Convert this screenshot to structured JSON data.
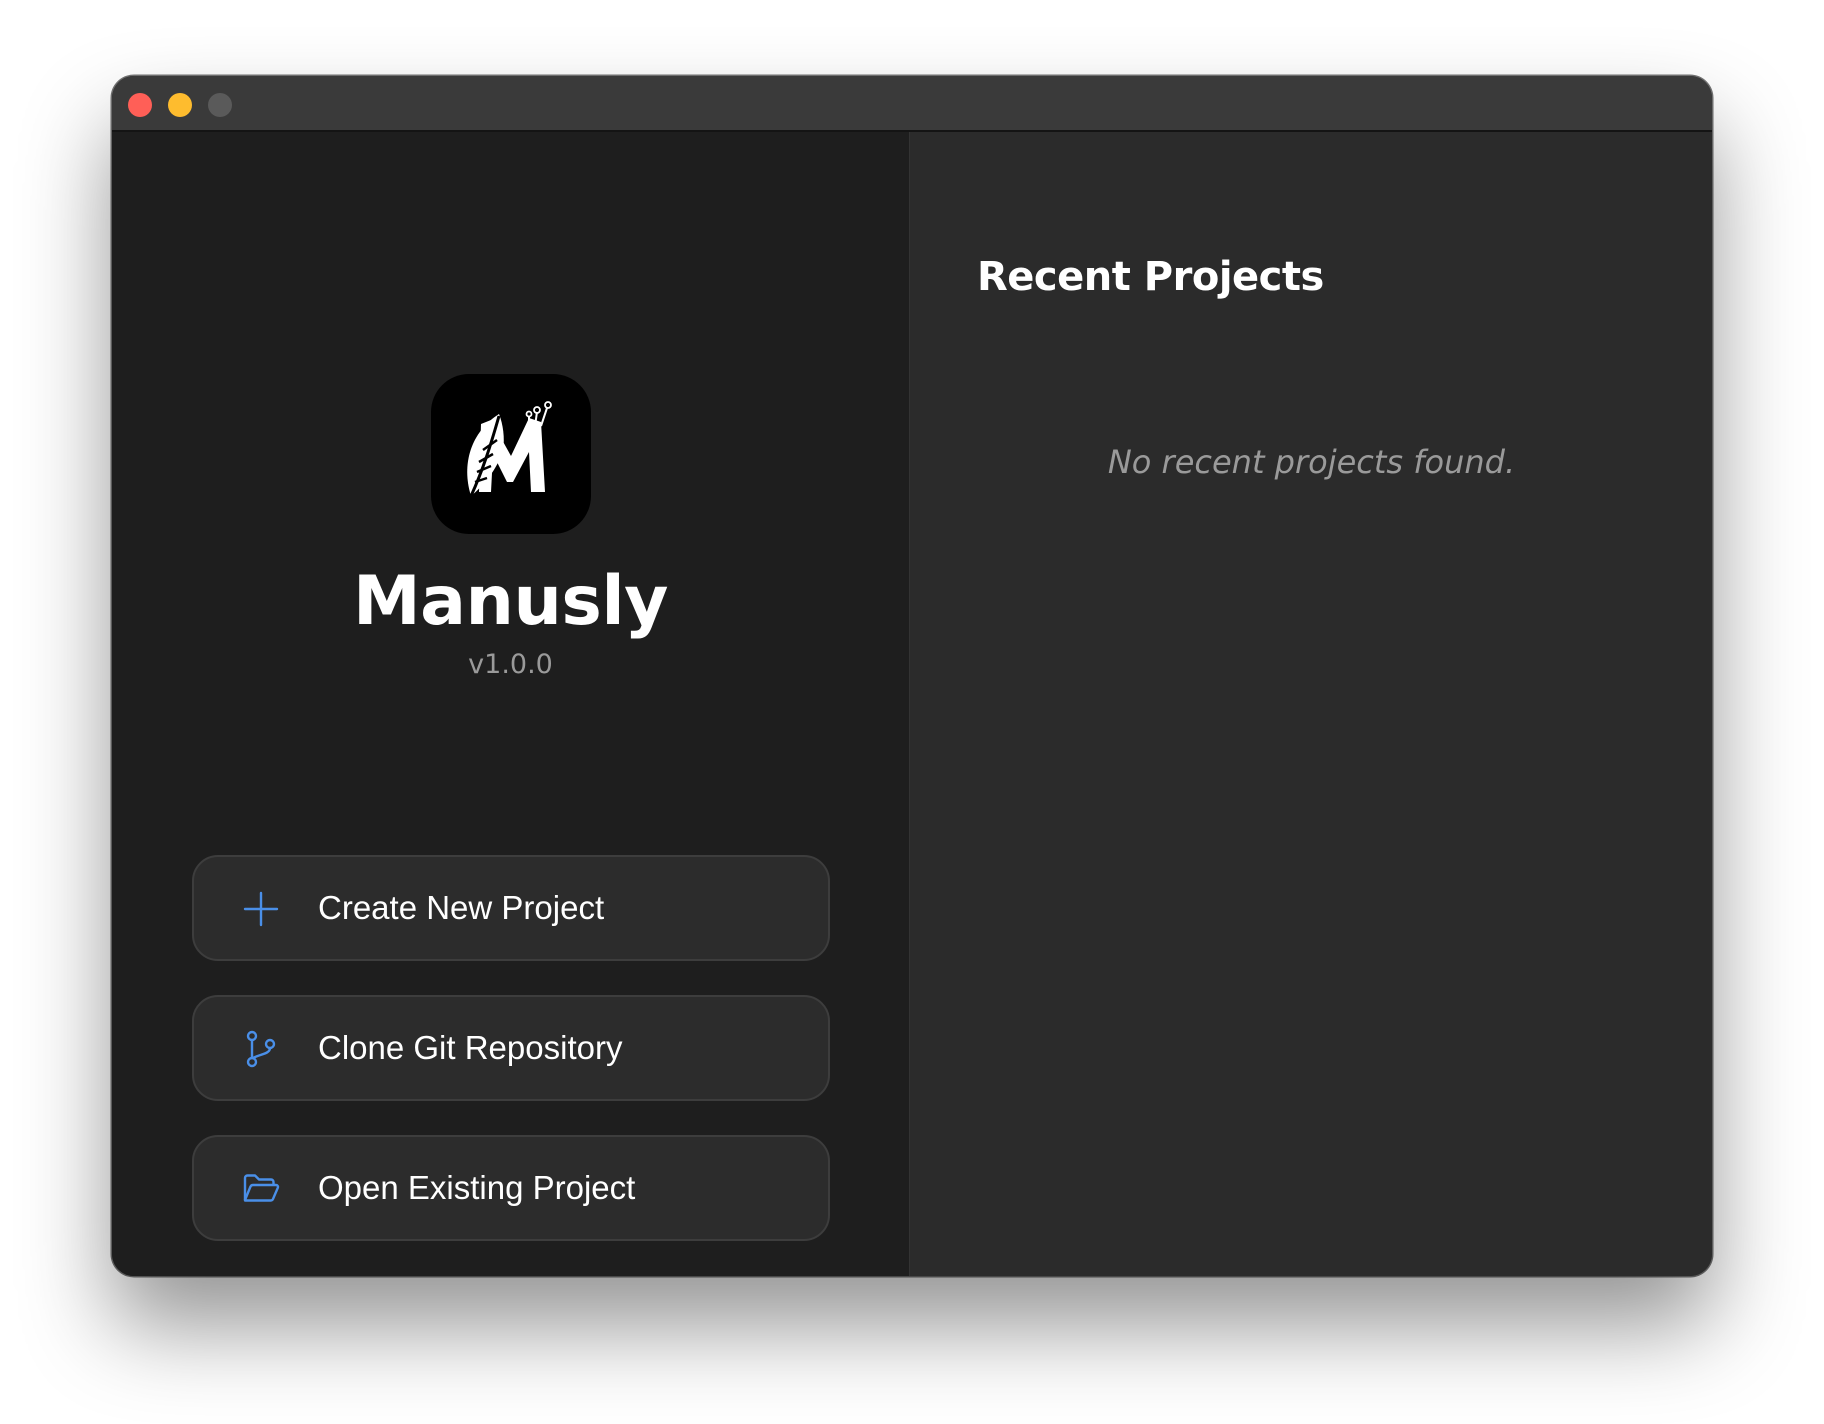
{
  "window": {
    "controls": [
      "close",
      "minimize",
      "zoom"
    ]
  },
  "app": {
    "logo_icon": "quill-m-logo-icon",
    "name": "Manusly",
    "version": "v1.0.0"
  },
  "actions": [
    {
      "label": "Create New Project",
      "icon": "plus-icon"
    },
    {
      "label": "Clone Git Repository",
      "icon": "git-branch-icon"
    },
    {
      "label": "Open Existing Project",
      "icon": "folder-open-icon"
    }
  ],
  "recent": {
    "title": "Recent Projects",
    "empty_message": "No recent projects found."
  },
  "colors": {
    "accent": "#4a8fe8",
    "left_pane_bg": "#1e1e1e",
    "right_pane_bg": "#2b2b2b",
    "titlebar_bg": "#3a3a3a",
    "close": "#ff5f57",
    "minimize": "#febc2e",
    "zoom_inactive": "#5a5a5a"
  }
}
